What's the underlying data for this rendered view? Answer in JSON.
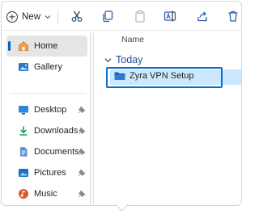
{
  "toolbar": {
    "new_label": "New",
    "icons": [
      "new-plus-icon",
      "chevron-down-icon",
      "cut-icon",
      "copy-icon",
      "paste-icon",
      "rename-icon",
      "share-icon",
      "delete-icon"
    ]
  },
  "sidebar": {
    "items": [
      {
        "label": "Home",
        "icon": "home-icon",
        "selected": true
      },
      {
        "label": "Gallery",
        "icon": "gallery-icon"
      },
      {
        "label": "Desktop",
        "icon": "desktop-icon",
        "pinned": true
      },
      {
        "label": "Downloads",
        "icon": "download-icon",
        "pinned": true
      },
      {
        "label": "Documents",
        "icon": "documents-icon",
        "pinned": true
      },
      {
        "label": "Pictures",
        "icon": "pictures-icon",
        "pinned": true
      },
      {
        "label": "Music",
        "icon": "music-icon",
        "pinned": true
      }
    ]
  },
  "content": {
    "column_header": "Name",
    "group_label": "Today",
    "files": [
      {
        "name": "Zyra VPN Setup",
        "icon": "folder-icon",
        "selected": true
      }
    ]
  },
  "colors": {
    "accent": "#0067c0",
    "selection": "#cce8ff",
    "focus_border": "#0a6ed1",
    "group_text": "#1f4e8c"
  }
}
